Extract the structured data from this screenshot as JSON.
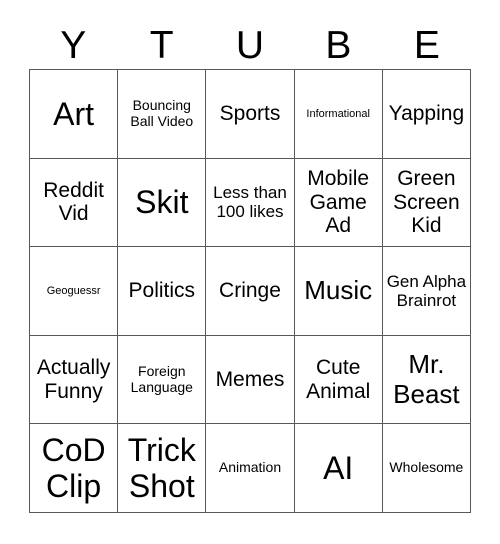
{
  "header": {
    "letters": [
      "Y",
      "T",
      "U",
      "B",
      "E"
    ]
  },
  "grid": {
    "columns": 5,
    "rows": 5,
    "border_color": "#595959",
    "background_color": "#ffffff",
    "text_color": "#000000",
    "cells": [
      {
        "text": "Art",
        "size": "fs-xxl"
      },
      {
        "text": "Bouncing Ball Video",
        "size": "fs-s"
      },
      {
        "text": "Sports",
        "size": "fs-l"
      },
      {
        "text": "Informational",
        "size": "fs-xs"
      },
      {
        "text": "Yapping",
        "size": "fs-l"
      },
      {
        "text": "Reddit Vid",
        "size": "fs-l"
      },
      {
        "text": "Skit",
        "size": "fs-xxl"
      },
      {
        "text": "Less than 100 likes",
        "size": "fs-m"
      },
      {
        "text": "Mobile Game Ad",
        "size": "fs-l"
      },
      {
        "text": "Green Screen Kid",
        "size": "fs-l"
      },
      {
        "text": "Geoguessr",
        "size": "fs-xs"
      },
      {
        "text": "Politics",
        "size": "fs-l"
      },
      {
        "text": "Cringe",
        "size": "fs-l"
      },
      {
        "text": "Music",
        "size": "fs-xl"
      },
      {
        "text": "Gen Alpha Brainrot",
        "size": "fs-m"
      },
      {
        "text": "Actually Funny",
        "size": "fs-l"
      },
      {
        "text": "Foreign Language",
        "size": "fs-s"
      },
      {
        "text": "Memes",
        "size": "fs-l"
      },
      {
        "text": "Cute Animal",
        "size": "fs-l"
      },
      {
        "text": "Mr. Beast",
        "size": "fs-xl"
      },
      {
        "text": "CoD Clip",
        "size": "fs-xxl"
      },
      {
        "text": "Trick Shot",
        "size": "fs-xxl"
      },
      {
        "text": "Animation",
        "size": "fs-s"
      },
      {
        "text": "AI",
        "size": "fs-xxl"
      },
      {
        "text": "Wholesome",
        "size": "fs-s"
      }
    ]
  }
}
